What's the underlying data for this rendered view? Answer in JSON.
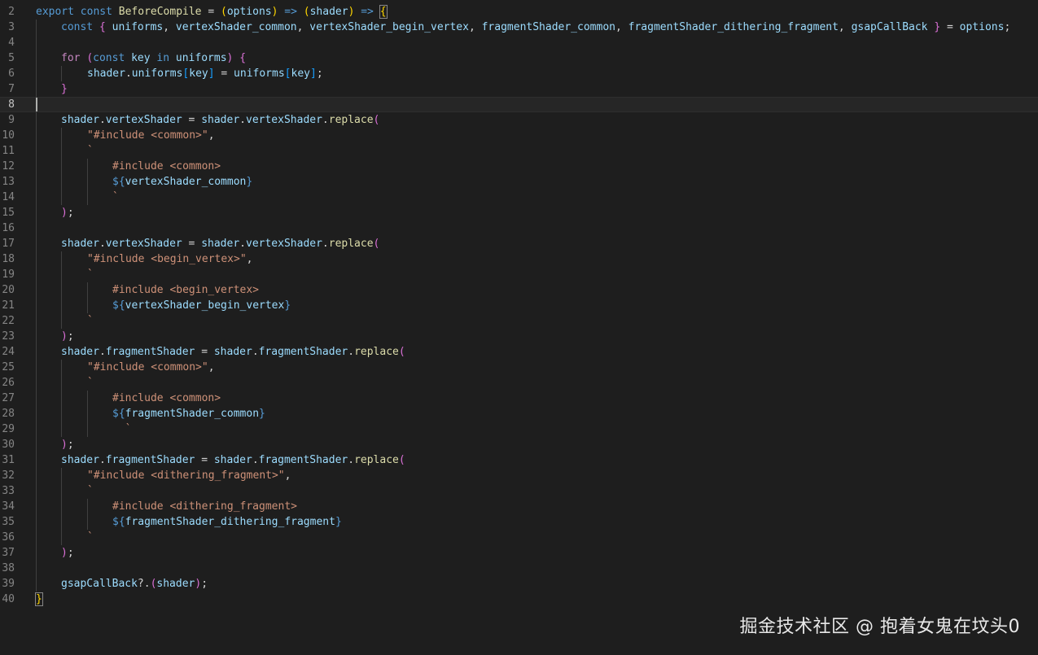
{
  "editor": {
    "current_line": 8,
    "lines": [
      {
        "n": 2,
        "indent": 0,
        "tokens": [
          [
            "export",
            "kw"
          ],
          [
            " ",
            "pl"
          ],
          [
            "const",
            "kw"
          ],
          [
            " ",
            "pl"
          ],
          [
            "BeforeCompile",
            "fn"
          ],
          [
            " = ",
            "pl"
          ],
          [
            "(",
            "p1"
          ],
          [
            "options",
            "vr"
          ],
          [
            ")",
            "p1"
          ],
          [
            " ",
            "pl"
          ],
          [
            "=>",
            "kw"
          ],
          [
            " ",
            "pl"
          ],
          [
            "(",
            "p1"
          ],
          [
            "shader",
            "vr"
          ],
          [
            ")",
            "p1"
          ],
          [
            " ",
            "pl"
          ],
          [
            "=>",
            "kw"
          ],
          [
            " ",
            "pl"
          ],
          [
            "{",
            "p1 bm"
          ]
        ]
      },
      {
        "n": 3,
        "indent": 1,
        "tokens": [
          [
            "const",
            "kw"
          ],
          [
            " ",
            "pl"
          ],
          [
            "{",
            "p2"
          ],
          [
            " ",
            "pl"
          ],
          [
            "uniforms",
            "vr"
          ],
          [
            ", ",
            "pl"
          ],
          [
            "vertexShader_common",
            "vr"
          ],
          [
            ", ",
            "pl"
          ],
          [
            "vertexShader_begin_vertex",
            "vr"
          ],
          [
            ", ",
            "pl"
          ],
          [
            "fragmentShader_common",
            "vr"
          ],
          [
            ", ",
            "pl"
          ],
          [
            "fragmentShader_dithering_fragment",
            "vr"
          ],
          [
            ", ",
            "pl"
          ],
          [
            "gsapCallBack",
            "vr"
          ],
          [
            " ",
            "pl"
          ],
          [
            "}",
            "p2"
          ],
          [
            " = ",
            "pl"
          ],
          [
            "options",
            "vr"
          ],
          [
            ";",
            "pl"
          ]
        ]
      },
      {
        "n": 4,
        "indent": 1,
        "tokens": []
      },
      {
        "n": 5,
        "indent": 1,
        "tokens": [
          [
            "for",
            "ctl"
          ],
          [
            " ",
            "pl"
          ],
          [
            "(",
            "p2"
          ],
          [
            "const",
            "kw"
          ],
          [
            " ",
            "pl"
          ],
          [
            "key",
            "vr"
          ],
          [
            " ",
            "pl"
          ],
          [
            "in",
            "kw"
          ],
          [
            " ",
            "pl"
          ],
          [
            "uniforms",
            "vr"
          ],
          [
            ")",
            "p2"
          ],
          [
            " ",
            "pl"
          ],
          [
            "{",
            "p2"
          ]
        ]
      },
      {
        "n": 6,
        "indent": 2,
        "tokens": [
          [
            "shader",
            "vr"
          ],
          [
            ".",
            "pl"
          ],
          [
            "uniforms",
            "vr"
          ],
          [
            "[",
            "p3"
          ],
          [
            "key",
            "vr"
          ],
          [
            "]",
            "p3"
          ],
          [
            " = ",
            "pl"
          ],
          [
            "uniforms",
            "vr"
          ],
          [
            "[",
            "p3"
          ],
          [
            "key",
            "vr"
          ],
          [
            "]",
            "p3"
          ],
          [
            ";",
            "pl"
          ]
        ]
      },
      {
        "n": 7,
        "indent": 1,
        "tokens": [
          [
            "}",
            "p2"
          ]
        ]
      },
      {
        "n": 8,
        "indent": 1,
        "tokens": []
      },
      {
        "n": 9,
        "indent": 1,
        "tokens": [
          [
            "shader",
            "vr"
          ],
          [
            ".",
            "pl"
          ],
          [
            "vertexShader",
            "vr"
          ],
          [
            " = ",
            "pl"
          ],
          [
            "shader",
            "vr"
          ],
          [
            ".",
            "pl"
          ],
          [
            "vertexShader",
            "vr"
          ],
          [
            ".",
            "pl"
          ],
          [
            "replace",
            "fn"
          ],
          [
            "(",
            "p2"
          ]
        ]
      },
      {
        "n": 10,
        "indent": 2,
        "tokens": [
          [
            "\"#include <common>\"",
            "str"
          ],
          [
            ",",
            "pl"
          ]
        ]
      },
      {
        "n": 11,
        "indent": 2,
        "tokens": [
          [
            "`",
            "str"
          ]
        ]
      },
      {
        "n": 12,
        "indent": 3,
        "tokens": [
          [
            "#include <common>",
            "str"
          ]
        ]
      },
      {
        "n": 13,
        "indent": 3,
        "tokens": [
          [
            "${",
            "kw"
          ],
          [
            "vertexShader_common",
            "vr"
          ],
          [
            "}",
            "kw"
          ]
        ]
      },
      {
        "n": 14,
        "indent": 3,
        "tokens": [
          [
            "`",
            "str"
          ]
        ]
      },
      {
        "n": 15,
        "indent": 1,
        "tokens": [
          [
            ")",
            "p2"
          ],
          [
            ";",
            "pl"
          ]
        ]
      },
      {
        "n": 16,
        "indent": 1,
        "tokens": []
      },
      {
        "n": 17,
        "indent": 1,
        "tokens": [
          [
            "shader",
            "vr"
          ],
          [
            ".",
            "pl"
          ],
          [
            "vertexShader",
            "vr"
          ],
          [
            " = ",
            "pl"
          ],
          [
            "shader",
            "vr"
          ],
          [
            ".",
            "pl"
          ],
          [
            "vertexShader",
            "vr"
          ],
          [
            ".",
            "pl"
          ],
          [
            "replace",
            "fn"
          ],
          [
            "(",
            "p2"
          ]
        ]
      },
      {
        "n": 18,
        "indent": 2,
        "tokens": [
          [
            "\"#include <begin_vertex>\"",
            "str"
          ],
          [
            ",",
            "pl"
          ]
        ]
      },
      {
        "n": 19,
        "indent": 2,
        "tokens": [
          [
            "`",
            "str"
          ]
        ]
      },
      {
        "n": 20,
        "indent": 3,
        "tokens": [
          [
            "#include <begin_vertex>",
            "str"
          ]
        ]
      },
      {
        "n": 21,
        "indent": 3,
        "tokens": [
          [
            "${",
            "kw"
          ],
          [
            "vertexShader_begin_vertex",
            "vr"
          ],
          [
            "}",
            "kw"
          ]
        ]
      },
      {
        "n": 22,
        "indent": 2,
        "tokens": [
          [
            "`",
            "str"
          ]
        ]
      },
      {
        "n": 23,
        "indent": 1,
        "tokens": [
          [
            ")",
            "p2"
          ],
          [
            ";",
            "pl"
          ]
        ]
      },
      {
        "n": 24,
        "indent": 1,
        "tokens": [
          [
            "shader",
            "vr"
          ],
          [
            ".",
            "pl"
          ],
          [
            "fragmentShader",
            "vr"
          ],
          [
            " = ",
            "pl"
          ],
          [
            "shader",
            "vr"
          ],
          [
            ".",
            "pl"
          ],
          [
            "fragmentShader",
            "vr"
          ],
          [
            ".",
            "pl"
          ],
          [
            "replace",
            "fn"
          ],
          [
            "(",
            "p2"
          ]
        ]
      },
      {
        "n": 25,
        "indent": 2,
        "tokens": [
          [
            "\"#include <common>\"",
            "str"
          ],
          [
            ",",
            "pl"
          ]
        ]
      },
      {
        "n": 26,
        "indent": 2,
        "tokens": [
          [
            "`",
            "str"
          ]
        ]
      },
      {
        "n": 27,
        "indent": 3,
        "tokens": [
          [
            "#include <common>",
            "str"
          ]
        ]
      },
      {
        "n": 28,
        "indent": 3,
        "tokens": [
          [
            "${",
            "kw"
          ],
          [
            "fragmentShader_common",
            "vr"
          ],
          [
            "}",
            "kw"
          ]
        ]
      },
      {
        "n": 29,
        "indent": 3,
        "tokens": [
          [
            "  `",
            "str"
          ]
        ]
      },
      {
        "n": 30,
        "indent": 1,
        "tokens": [
          [
            ")",
            "p2"
          ],
          [
            ";",
            "pl"
          ]
        ]
      },
      {
        "n": 31,
        "indent": 1,
        "tokens": [
          [
            "shader",
            "vr"
          ],
          [
            ".",
            "pl"
          ],
          [
            "fragmentShader",
            "vr"
          ],
          [
            " = ",
            "pl"
          ],
          [
            "shader",
            "vr"
          ],
          [
            ".",
            "pl"
          ],
          [
            "fragmentShader",
            "vr"
          ],
          [
            ".",
            "pl"
          ],
          [
            "replace",
            "fn"
          ],
          [
            "(",
            "p2"
          ]
        ]
      },
      {
        "n": 32,
        "indent": 2,
        "tokens": [
          [
            "\"#include <dithering_fragment>\"",
            "str"
          ],
          [
            ",",
            "pl"
          ]
        ]
      },
      {
        "n": 33,
        "indent": 2,
        "tokens": [
          [
            "`",
            "str"
          ]
        ]
      },
      {
        "n": 34,
        "indent": 3,
        "tokens": [
          [
            "#include <dithering_fragment>",
            "str"
          ]
        ]
      },
      {
        "n": 35,
        "indent": 3,
        "tokens": [
          [
            "${",
            "kw"
          ],
          [
            "fragmentShader_dithering_fragment",
            "vr"
          ],
          [
            "}",
            "kw"
          ]
        ]
      },
      {
        "n": 36,
        "indent": 2,
        "tokens": [
          [
            "`",
            "str"
          ]
        ]
      },
      {
        "n": 37,
        "indent": 1,
        "tokens": [
          [
            ")",
            "p2"
          ],
          [
            ";",
            "pl"
          ]
        ]
      },
      {
        "n": 38,
        "indent": 1,
        "tokens": []
      },
      {
        "n": 39,
        "indent": 1,
        "tokens": [
          [
            "gsapCallBack",
            "vr"
          ],
          [
            "?.",
            "pl"
          ],
          [
            "(",
            "p2"
          ],
          [
            "shader",
            "vr"
          ],
          [
            ")",
            "p2"
          ],
          [
            ";",
            "pl"
          ]
        ]
      },
      {
        "n": 40,
        "indent": 0,
        "tokens": [
          [
            "}",
            "p1 bm"
          ]
        ]
      }
    ]
  },
  "watermark": {
    "text": "掘金技术社区 @ 抱着女鬼在坟头0"
  }
}
